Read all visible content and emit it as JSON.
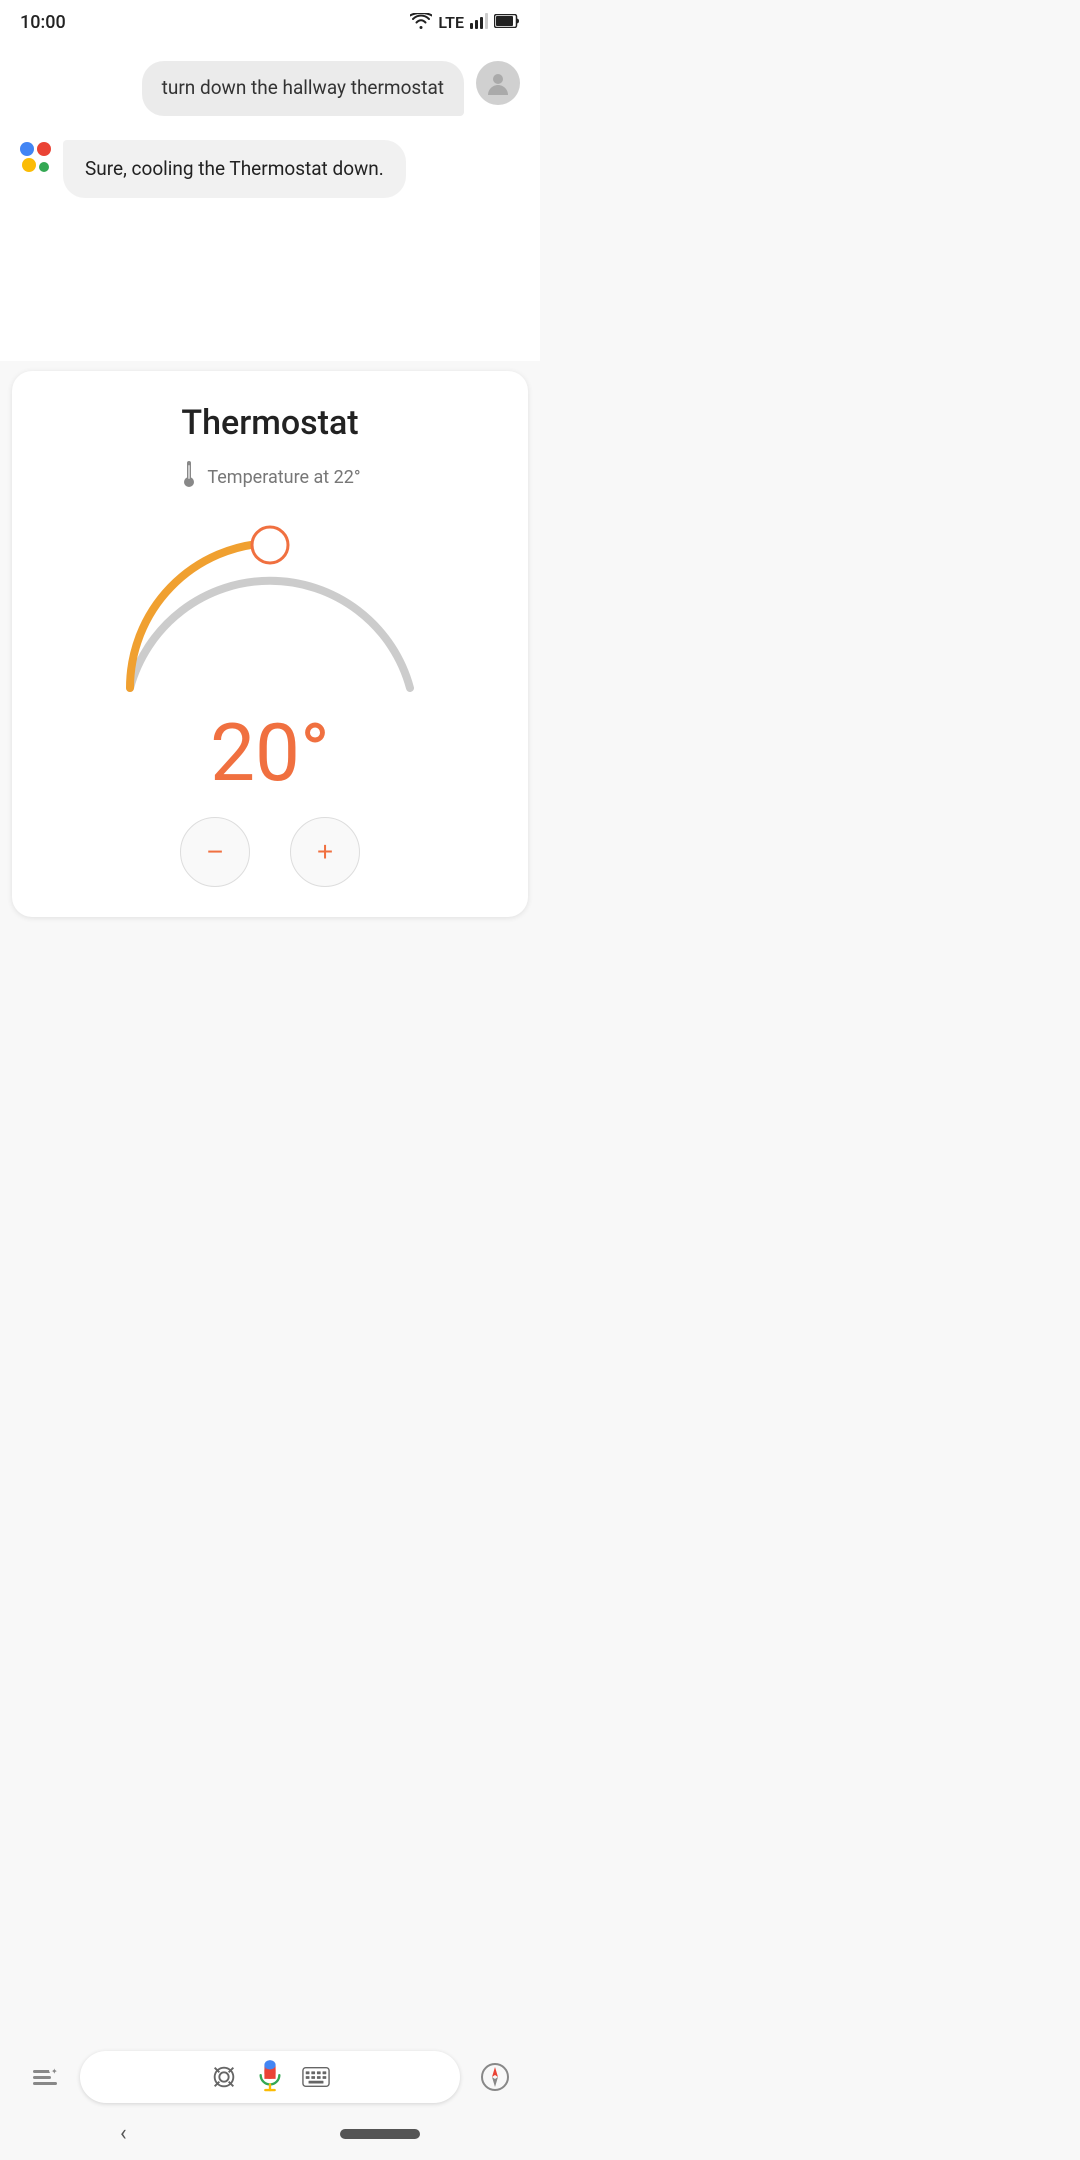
{
  "statusBar": {
    "time": "10:00",
    "networkLabel": "LTE"
  },
  "userMessage": {
    "text": "turn down the hallway thermostat"
  },
  "assistantMessage": {
    "text": "Sure, cooling the Thermostat down."
  },
  "thermostatCard": {
    "title": "Thermostat",
    "tempLabel": "Temperature at 22°",
    "currentTemp": "20°",
    "minusLabel": "−",
    "plusLabel": "+"
  },
  "bottomBar": {
    "lensIconLabel": "lens-icon",
    "micIconLabel": "microphone-icon",
    "keyboardIconLabel": "keyboard-icon",
    "compassIconLabel": "compass-icon",
    "assistantIconLabel": "assistant-icon"
  },
  "colors": {
    "dialActive": "#f0a030",
    "dialInactive": "#cccccc",
    "dialHandle": "#f07040",
    "tempText": "#f07040"
  }
}
